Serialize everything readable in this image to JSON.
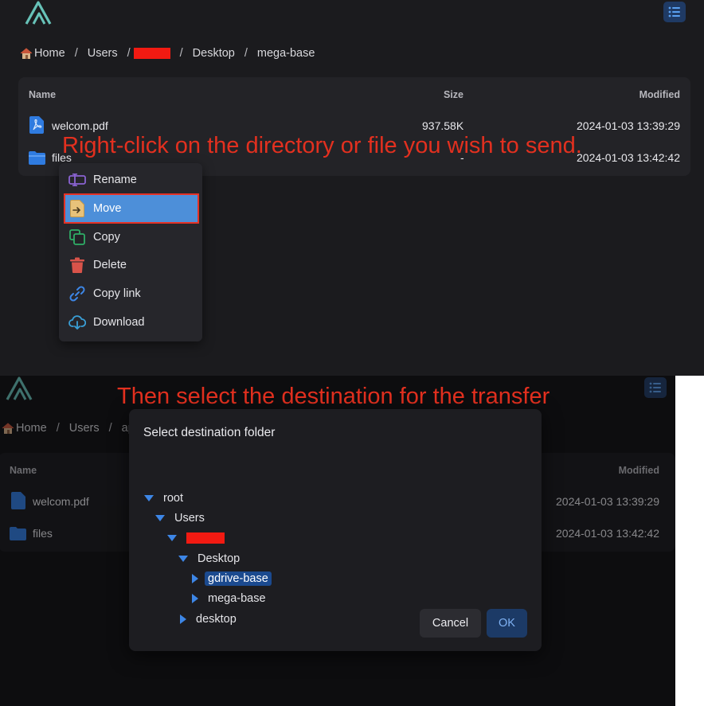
{
  "panel1": {
    "breadcrumb": {
      "home": "Home",
      "users": "Users",
      "desktop": "Desktop",
      "current": "mega-base",
      "separator": "/"
    },
    "table": {
      "headers": {
        "name": "Name",
        "size": "Size",
        "modified": "Modified"
      },
      "rows": [
        {
          "icon": "pdf-file-icon",
          "name": "welcom.pdf",
          "size": "937.58K",
          "modified": "2024-01-03 13:39:29"
        },
        {
          "icon": "folder-icon",
          "name": "files",
          "size": "-",
          "modified": "2024-01-03 13:42:42"
        }
      ]
    },
    "annotation": "Right-click on the directory or file you wish to send.",
    "context_menu": {
      "items": [
        {
          "icon": "rename-icon",
          "label": "Rename"
        },
        {
          "icon": "move-icon",
          "label": "Move"
        },
        {
          "icon": "copy-icon",
          "label": "Copy"
        },
        {
          "icon": "trash-icon",
          "label": "Delete"
        },
        {
          "icon": "link-icon",
          "label": "Copy link"
        },
        {
          "icon": "cloud-download-icon",
          "label": "Download"
        }
      ],
      "highlighted": "Move"
    }
  },
  "panel2": {
    "annotation": "Then select the destination for the transfer",
    "breadcrumb": {
      "home": "Home",
      "users": "Users",
      "partial": "ap"
    },
    "table": {
      "headers": {
        "name": "Name",
        "modified": "Modified"
      },
      "rows": [
        {
          "name": "welcom.pdf",
          "modified": "2024-01-03 13:39:29"
        },
        {
          "name": "files",
          "modified": "2024-01-03 13:42:42"
        }
      ]
    },
    "dialog": {
      "title": "Select destination folder",
      "tree": {
        "root": "root",
        "users": "Users",
        "desktop_upper": "Desktop",
        "gdrive_base": "gdrive-base",
        "mega_base": "mega-base",
        "desktop_lower": "desktop"
      },
      "selected": "gdrive-base",
      "cancel_label": "Cancel",
      "ok_label": "OK"
    }
  },
  "colors": {
    "accent": "#3d86e6",
    "annotation": "#e3301f",
    "redaction": "#f21a12",
    "menu_highlight": "#4d8fd9"
  }
}
